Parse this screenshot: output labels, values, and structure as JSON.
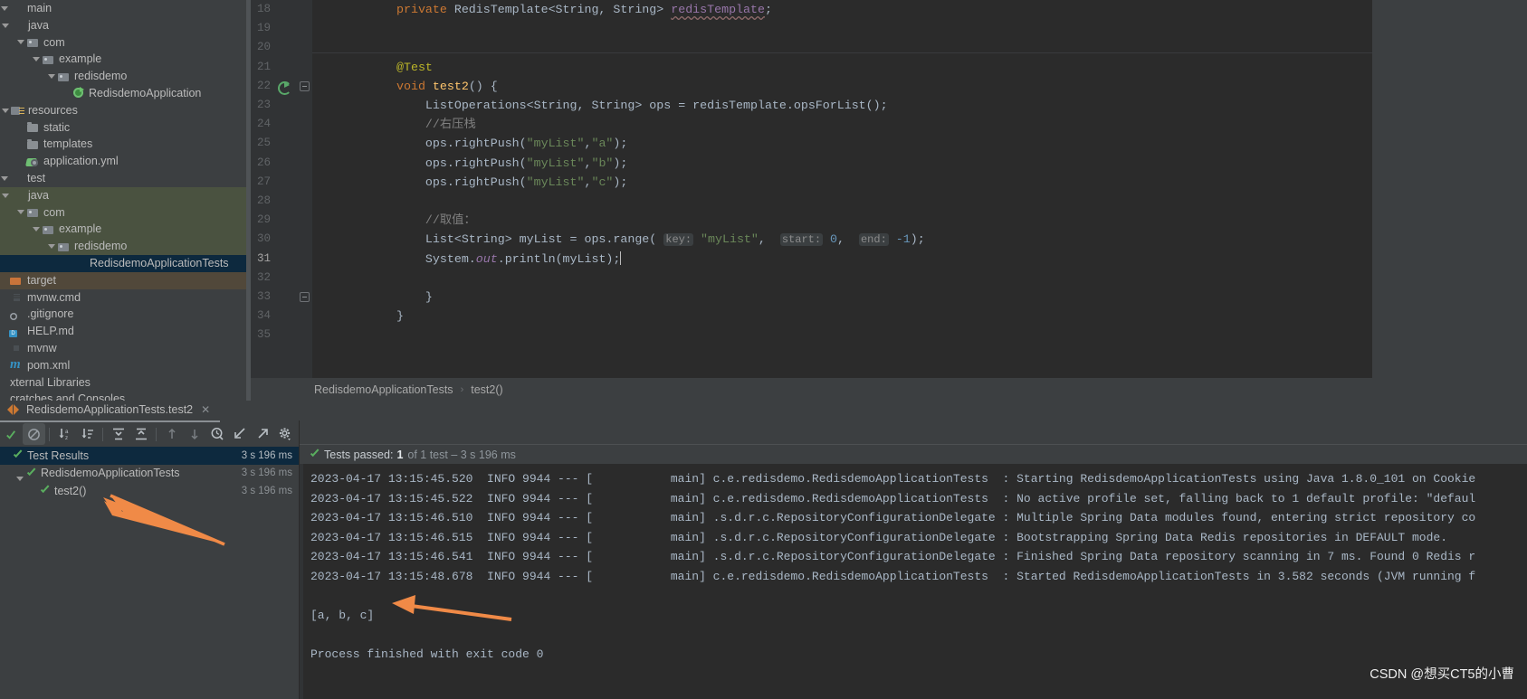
{
  "project_tree": {
    "items": [
      {
        "label": "main",
        "depth": 0,
        "arrow": "down",
        "icon": "folder-src",
        "state": "none"
      },
      {
        "label": "java",
        "depth": 1,
        "arrow": "down",
        "icon": "folder-blue",
        "state": "none"
      },
      {
        "label": "com",
        "depth": 2,
        "arrow": "down",
        "icon": "pkg",
        "state": "none"
      },
      {
        "label": "example",
        "depth": 3,
        "arrow": "down",
        "icon": "pkg",
        "state": "none"
      },
      {
        "label": "redisdemo",
        "depth": 4,
        "arrow": "down",
        "icon": "pkg",
        "state": "none"
      },
      {
        "label": "RedisdemoApplication",
        "depth": 5,
        "arrow": "none",
        "icon": "spring",
        "state": "none"
      },
      {
        "label": "resources",
        "depth": 1,
        "arrow": "down",
        "icon": "res",
        "state": "none"
      },
      {
        "label": "static",
        "depth": 2,
        "arrow": "none",
        "icon": "folder",
        "state": "none"
      },
      {
        "label": "templates",
        "depth": 2,
        "arrow": "none",
        "icon": "folder",
        "state": "none"
      },
      {
        "label": "application.yml",
        "depth": 2,
        "arrow": "none",
        "icon": "yml",
        "state": "none"
      },
      {
        "label": "test",
        "depth": 0,
        "arrow": "down",
        "icon": "folder-src",
        "state": "none"
      },
      {
        "label": "java",
        "depth": 1,
        "arrow": "down",
        "icon": "folder-green",
        "state": "green"
      },
      {
        "label": "com",
        "depth": 2,
        "arrow": "down",
        "icon": "pkg",
        "state": "green"
      },
      {
        "label": "example",
        "depth": 3,
        "arrow": "down",
        "icon": "pkg",
        "state": "green"
      },
      {
        "label": "redisdemo",
        "depth": 4,
        "arrow": "down",
        "icon": "pkg",
        "state": "green"
      },
      {
        "label": "RedisdemoApplicationTests",
        "depth": 5,
        "arrow": "none",
        "icon": "spring-blue",
        "state": "blue"
      },
      {
        "label": "target",
        "depth": 0,
        "arrow": "none",
        "icon": "target",
        "state": "brown"
      },
      {
        "label": "mvnw.cmd",
        "depth": 0,
        "arrow": "none",
        "icon": "file-cmd",
        "state": "none"
      },
      {
        "label": ".gitignore",
        "depth": 0,
        "arrow": "none",
        "icon": "file-git",
        "state": "none"
      },
      {
        "label": "HELP.md",
        "depth": 0,
        "arrow": "none",
        "icon": "file-md",
        "state": "none"
      },
      {
        "label": "mvnw",
        "depth": 0,
        "arrow": "none",
        "icon": "file-sh",
        "state": "none"
      },
      {
        "label": "pom.xml",
        "depth": 0,
        "arrow": "none",
        "icon": "maven",
        "state": "none"
      },
      {
        "label": "xternal Libraries",
        "depth": 0,
        "arrow": "none",
        "icon": "none",
        "state": "none"
      },
      {
        "label": "cratches and Consoles",
        "depth": 0,
        "arrow": "none",
        "icon": "none",
        "state": "none"
      }
    ]
  },
  "editor": {
    "lines": [
      {
        "num": "18",
        "current": false
      },
      {
        "num": "19",
        "current": false
      },
      {
        "num": "20",
        "current": false
      },
      {
        "num": "21",
        "current": false
      },
      {
        "num": "22",
        "current": false
      },
      {
        "num": "23",
        "current": false
      },
      {
        "num": "24",
        "current": false
      },
      {
        "num": "25",
        "current": false
      },
      {
        "num": "26",
        "current": false
      },
      {
        "num": "27",
        "current": false
      },
      {
        "num": "28",
        "current": false
      },
      {
        "num": "29",
        "current": false
      },
      {
        "num": "30",
        "current": false
      },
      {
        "num": "31",
        "current": true
      },
      {
        "num": "32",
        "current": false
      },
      {
        "num": "33",
        "current": false
      },
      {
        "num": "34",
        "current": false
      },
      {
        "num": "35",
        "current": false
      }
    ],
    "code": {
      "l18_kw": "private",
      "l18_type": " RedisTemplate<String, String> ",
      "l18_field": "redisTemplate",
      "l18_end": ";",
      "l21_anno": "@Test",
      "l22_kw": "void",
      "l22_name": " test2",
      "l22_rest": "() {",
      "l23": "    ListOperations<String, String> ops = redisTemplate.opsForList();",
      "l24": "    //右压栈",
      "l25_pre": "    ops.rightPush(",
      "l25_a": "\"myList\"",
      "l25_mid": ",",
      "l25_b": "\"a\"",
      "l25_end": ");",
      "l26_a": "\"myList\"",
      "l26_b": "\"b\"",
      "l27_a": "\"myList\"",
      "l27_b": "\"c\"",
      "l29": "    //取值：",
      "l30_pre": "    List<String> myList = ops.range(",
      "l30_hint_key": "key:",
      "l30_key": "\"myList\"",
      "l30_hint_start": "start:",
      "l30_start": "0",
      "l30_hint_end": "end:",
      "l30_end": "-1",
      "l30_tail": ");",
      "l31_pre": "    System.",
      "l31_out": "out",
      "l31_post": ".println(myList);",
      "l33": "    }",
      "l34": "}"
    },
    "breadcrumb": {
      "class": "RedisdemoApplicationTests",
      "separator": "›",
      "method": "test2()"
    }
  },
  "run_panel": {
    "tab": {
      "label": "RedisdemoApplicationTests.test2",
      "close": "✕"
    },
    "toolbar_icons": [
      "rerun-tests-icon",
      "stop-icon",
      "sort-alphabetically-icon",
      "sort-by-duration-icon",
      "expand-all-icon",
      "collapse-all-icon",
      "previous-failed-icon",
      "next-failed-icon",
      "test-history-icon",
      "import-tests-icon",
      "export-tests-icon",
      "settings-icon"
    ],
    "test_tree": [
      {
        "label": "Test Results",
        "duration": "3 s 196 ms",
        "depth": 0,
        "arrow": "none",
        "selected": true
      },
      {
        "label": "RedisdemoApplicationTests",
        "duration": "3 s 196 ms",
        "depth": 1,
        "arrow": "down",
        "selected": false
      },
      {
        "label": "test2()",
        "duration": "3 s 196 ms",
        "depth": 2,
        "arrow": "none",
        "selected": false
      }
    ],
    "status": {
      "label": "Tests passed:",
      "count": "1",
      "detail": "of 1 test – 3 s 196 ms"
    },
    "console_lines": [
      "2023-04-17 13:15:45.520  INFO 9944 --- [           main] c.e.redisdemo.RedisdemoApplicationTests  : Starting RedisdemoApplicationTests using Java 1.8.0_101 on Cookie",
      "2023-04-17 13:15:45.522  INFO 9944 --- [           main] c.e.redisdemo.RedisdemoApplicationTests  : No active profile set, falling back to 1 default profile: \"defaul",
      "2023-04-17 13:15:46.510  INFO 9944 --- [           main] .s.d.r.c.RepositoryConfigurationDelegate : Multiple Spring Data modules found, entering strict repository co",
      "2023-04-17 13:15:46.515  INFO 9944 --- [           main] .s.d.r.c.RepositoryConfigurationDelegate : Bootstrapping Spring Data Redis repositories in DEFAULT mode.",
      "2023-04-17 13:15:46.541  INFO 9944 --- [           main] .s.d.r.c.RepositoryConfigurationDelegate : Finished Spring Data repository scanning in 7 ms. Found 0 Redis r",
      "2023-04-17 13:15:48.678  INFO 9944 --- [           main] c.e.redisdemo.RedisdemoApplicationTests  : Started RedisdemoApplicationTests in 3.582 seconds (JVM running f",
      "",
      "[a, b, c]",
      "",
      "Process finished with exit code 0"
    ]
  },
  "watermark": {
    "text": "CSDN @想买CT5的小曹"
  },
  "colors": {
    "accent_orange": "#f08a47",
    "keyword": "#cc7832",
    "string": "#6a8759",
    "annotation": "#bbb529",
    "number": "#6897bb",
    "comment": "#808080",
    "selection_blue": "#0d293e",
    "selection_green": "#4a5240"
  }
}
